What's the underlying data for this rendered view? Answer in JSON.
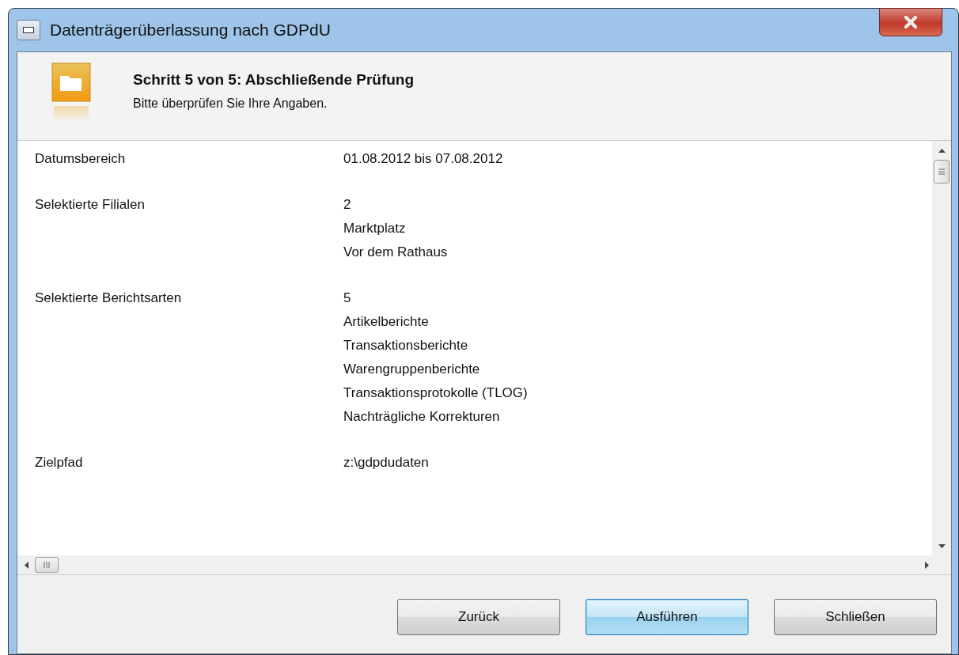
{
  "window": {
    "title": "Datenträgerüberlassung nach GDPdU"
  },
  "header": {
    "title": "Schritt 5 von 5: Abschließende Prüfung",
    "subtitle": "Bitte überprüfen Sie Ihre Angaben."
  },
  "summary": [
    {
      "label": "Datumsbereich",
      "values": [
        "01.08.2012 bis 07.08.2012"
      ]
    },
    {
      "label": "Selektierte Filialen",
      "values": [
        "2",
        "Marktplatz",
        "Vor dem Rathaus"
      ]
    },
    {
      "label": "Selektierte Berichtsarten",
      "values": [
        "5",
        "Artikelberichte",
        "Transaktionsberichte",
        "Warengruppenberichte",
        "Transaktionsprotokolle (TLOG)",
        "Nachträgliche Korrekturen"
      ]
    },
    {
      "label": "Zielpfad",
      "values": [
        "z:\\gdpdudaten"
      ]
    }
  ],
  "buttons": [
    {
      "label": "Zurück",
      "default": false
    },
    {
      "label": "Ausführen",
      "default": true
    },
    {
      "label": "Schließen",
      "default": false
    }
  ]
}
